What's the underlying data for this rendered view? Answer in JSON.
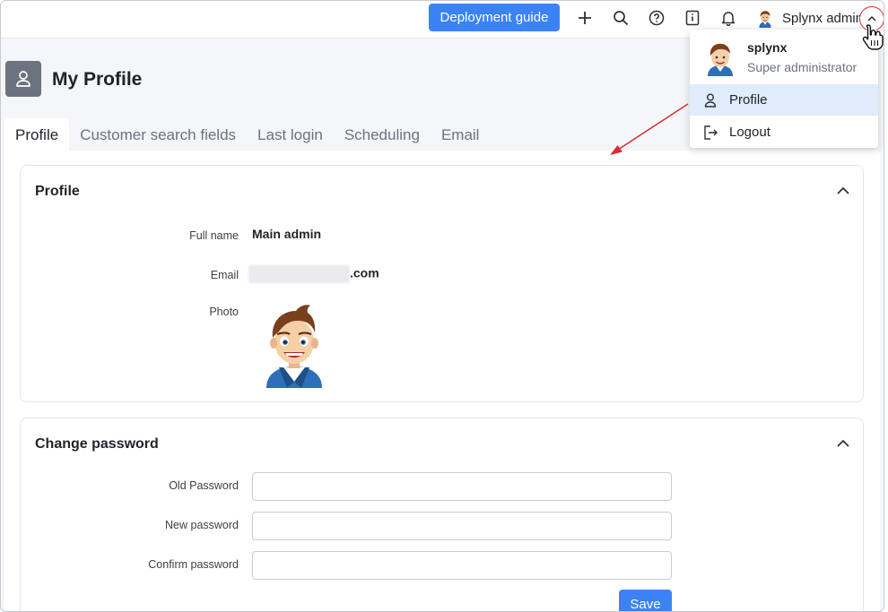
{
  "topbar": {
    "deploy_label": "Deployment guide",
    "user_name": "Splynx admin"
  },
  "page": {
    "title": "My Profile"
  },
  "tabs": [
    {
      "label": "Profile",
      "active": true
    },
    {
      "label": "Customer search fields"
    },
    {
      "label": "Last login"
    },
    {
      "label": "Scheduling"
    },
    {
      "label": "Email"
    }
  ],
  "profile_card": {
    "title": "Profile",
    "full_name_label": "Full name",
    "full_name_value": "Main admin",
    "email_label": "Email",
    "email_suffix": ".com",
    "photo_label": "Photo"
  },
  "password_card": {
    "title": "Change password",
    "old_label": "Old Password",
    "new_label": "New password",
    "confirm_label": "Confirm password",
    "save_label": "Save"
  },
  "dropdown": {
    "name": "splynx",
    "role": "Super administrator",
    "profile_label": "Profile",
    "logout_label": "Logout"
  },
  "colors": {
    "accent": "#3b82f6",
    "annotation": "#d32f2f"
  }
}
